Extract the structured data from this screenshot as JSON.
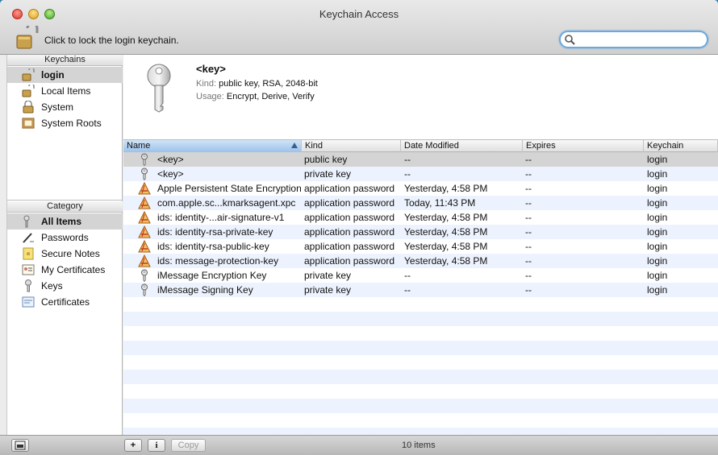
{
  "window": {
    "title": "Keychain Access"
  },
  "toolbar": {
    "lock_text": "Click to lock the login keychain.",
    "search_placeholder": ""
  },
  "sidebar": {
    "keychains_header": "Keychains",
    "keychains": [
      {
        "label": "login",
        "icon": "unlocked-padlock-icon",
        "selected": true
      },
      {
        "label": "Local Items",
        "icon": "unlocked-padlock-icon",
        "selected": false
      },
      {
        "label": "System",
        "icon": "locked-padlock-icon",
        "selected": false
      },
      {
        "label": "System Roots",
        "icon": "folder-cabinet-icon",
        "selected": false
      }
    ],
    "category_header": "Category",
    "categories": [
      {
        "label": "All Items",
        "icon": "people-keys-icon",
        "selected": true
      },
      {
        "label": "Passwords",
        "icon": "pen-icon",
        "selected": false
      },
      {
        "label": "Secure Notes",
        "icon": "note-icon",
        "selected": false
      },
      {
        "label": "My Certificates",
        "icon": "certificate-person-icon",
        "selected": false
      },
      {
        "label": "Keys",
        "icon": "key-icon",
        "selected": false
      },
      {
        "label": "Certificates",
        "icon": "certificate-icon",
        "selected": false
      }
    ]
  },
  "info": {
    "name": "<key>",
    "kind_label": "Kind:",
    "kind_value": "public key, RSA, 2048-bit",
    "usage_label": "Usage:",
    "usage_value": "Encrypt, Derive, Verify"
  },
  "table": {
    "columns": [
      "Name",
      "Kind",
      "Date Modified",
      "Expires",
      "Keychain"
    ],
    "rows": [
      {
        "icon": "key",
        "name": "<key>",
        "kind": "public key",
        "date": "--",
        "expires": "--",
        "keychain": "login",
        "selected": true
      },
      {
        "icon": "key",
        "name": "<key>",
        "kind": "private key",
        "date": "--",
        "expires": "--",
        "keychain": "login"
      },
      {
        "icon": "app",
        "name": "Apple Persistent State Encryption",
        "kind": "application password",
        "date": "Yesterday, 4:58 PM",
        "expires": "--",
        "keychain": "login"
      },
      {
        "icon": "app",
        "name": "com.apple.sc...kmarksagent.xpc",
        "kind": "application password",
        "date": "Today, 11:43 PM",
        "expires": "--",
        "keychain": "login"
      },
      {
        "icon": "app",
        "name": "ids: identity-...air-signature-v1",
        "kind": "application password",
        "date": "Yesterday, 4:58 PM",
        "expires": "--",
        "keychain": "login"
      },
      {
        "icon": "app",
        "name": "ids: identity-rsa-private-key",
        "kind": "application password",
        "date": "Yesterday, 4:58 PM",
        "expires": "--",
        "keychain": "login"
      },
      {
        "icon": "app",
        "name": "ids: identity-rsa-public-key",
        "kind": "application password",
        "date": "Yesterday, 4:58 PM",
        "expires": "--",
        "keychain": "login"
      },
      {
        "icon": "app",
        "name": "ids: message-protection-key",
        "kind": "application password",
        "date": "Yesterday, 4:58 PM",
        "expires": "--",
        "keychain": "login"
      },
      {
        "icon": "key",
        "name": "iMessage Encryption Key",
        "kind": "private key",
        "date": "--",
        "expires": "--",
        "keychain": "login"
      },
      {
        "icon": "key",
        "name": "iMessage Signing Key",
        "kind": "private key",
        "date": "--",
        "expires": "--",
        "keychain": "login"
      }
    ]
  },
  "bottombar": {
    "add_symbol": "+",
    "info_symbol": "i",
    "copy_label": "Copy",
    "count_text": "10 items"
  }
}
